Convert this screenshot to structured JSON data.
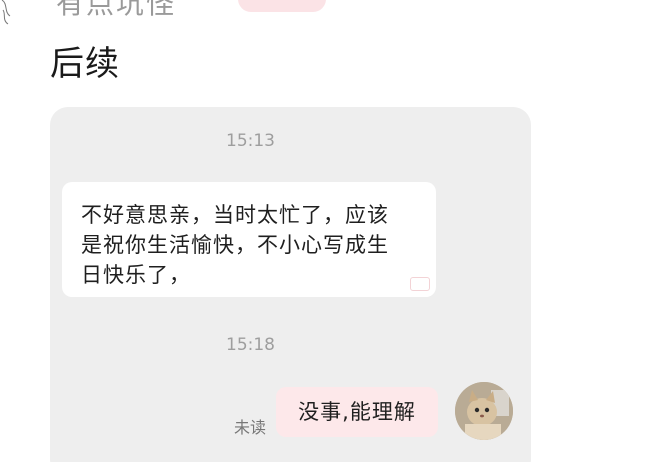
{
  "post": {
    "cut_title": "有点坑怪",
    "text": "后续"
  },
  "chat": {
    "messages": [
      {
        "time": "15:13",
        "lines": [
          "不好意思亲，当时太忙了，应该",
          "是祝你生活愉快，不小心写成生",
          "日快乐了，"
        ]
      },
      {
        "time": "15:18",
        "text": "没事,能理解",
        "status": "未读"
      }
    ]
  },
  "colors": {
    "chat_background": "#eeeeee",
    "incoming_bubble": "#ffffff",
    "outgoing_bubble": "#fde8ea",
    "timestamp": "#9e9e9e"
  },
  "icons": {
    "avatar": "cat-avatar-icon",
    "corner_sketch": "sketch-avatar-icon",
    "watermark": "watermark-icon"
  }
}
